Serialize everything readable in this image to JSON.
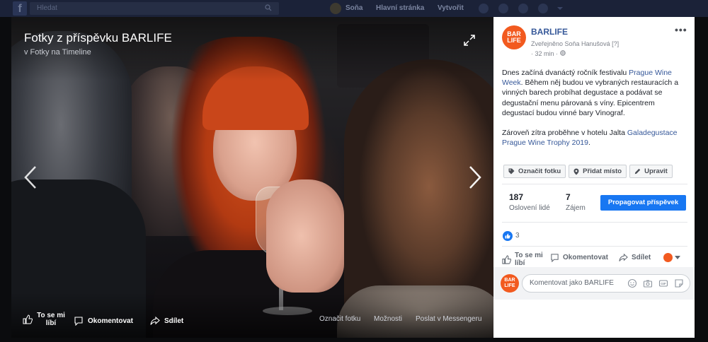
{
  "topbar": {
    "logo": "f",
    "search_placeholder": "Hledat",
    "user_name": "Soňa",
    "home_label": "Hlavní stránka",
    "create_label": "Vytvořit",
    "icons": [
      "friends-icon",
      "messenger-icon",
      "notifications-icon",
      "help-icon",
      "caret-icon"
    ]
  },
  "photo": {
    "title": "Fotky z příspěvku BARLIFE",
    "subtitle": "v Fotky na Timeline",
    "actions": {
      "like": "To se mi líbí",
      "comment": "Okomentovat",
      "share": "Sdílet"
    },
    "links": {
      "tag": "Označit fotku",
      "options": "Možnosti",
      "messenger": "Poslat v Messengeru"
    }
  },
  "panel": {
    "page_avatar_line1": "BAR",
    "page_avatar_line2": "LIFE",
    "page_name": "BARLIFE",
    "published_by": "Zveřejněno Soňa Hanušová",
    "published_help": "[?]",
    "time": "· 32 min ·",
    "post": {
      "p1_a": "Dnes začíná dvanáctý ročník festivalu ",
      "p1_link": "Prague Wine Week",
      "p1_b": ". Během něj budou ve vybraných restauracích a vinných barech probíhat degustace a podávat se degustační menu párovaná s víny. Epicentrem degustací budou vinné bary Vinograf.",
      "p2_a": "Zároveň zítra proběhne v hotelu Jalta ",
      "p2_link": "Galadegustace Prague Wine Trophy 2019",
      "p2_b": "."
    },
    "buttons": {
      "tag_photo": "Označit fotku",
      "add_place": "Přidat místo",
      "edit": "Upravit"
    },
    "stats": {
      "reach_value": "187",
      "reach_label": "Oslovení lidé",
      "engagement_value": "7",
      "engagement_label": "Zájem"
    },
    "promote_label": "Propagovat příspěvek",
    "reactions_count": "3",
    "actions": {
      "like_line1": "To se mi",
      "like_line2": "líbí",
      "comment": "Okomentovat",
      "share": "Sdílet"
    },
    "comment_placeholder": "Komentovat jako BARLIFE"
  },
  "colors": {
    "brand_orange": "#f25a1f",
    "facebook_blue": "#1877f2",
    "link_blue": "#365899"
  }
}
